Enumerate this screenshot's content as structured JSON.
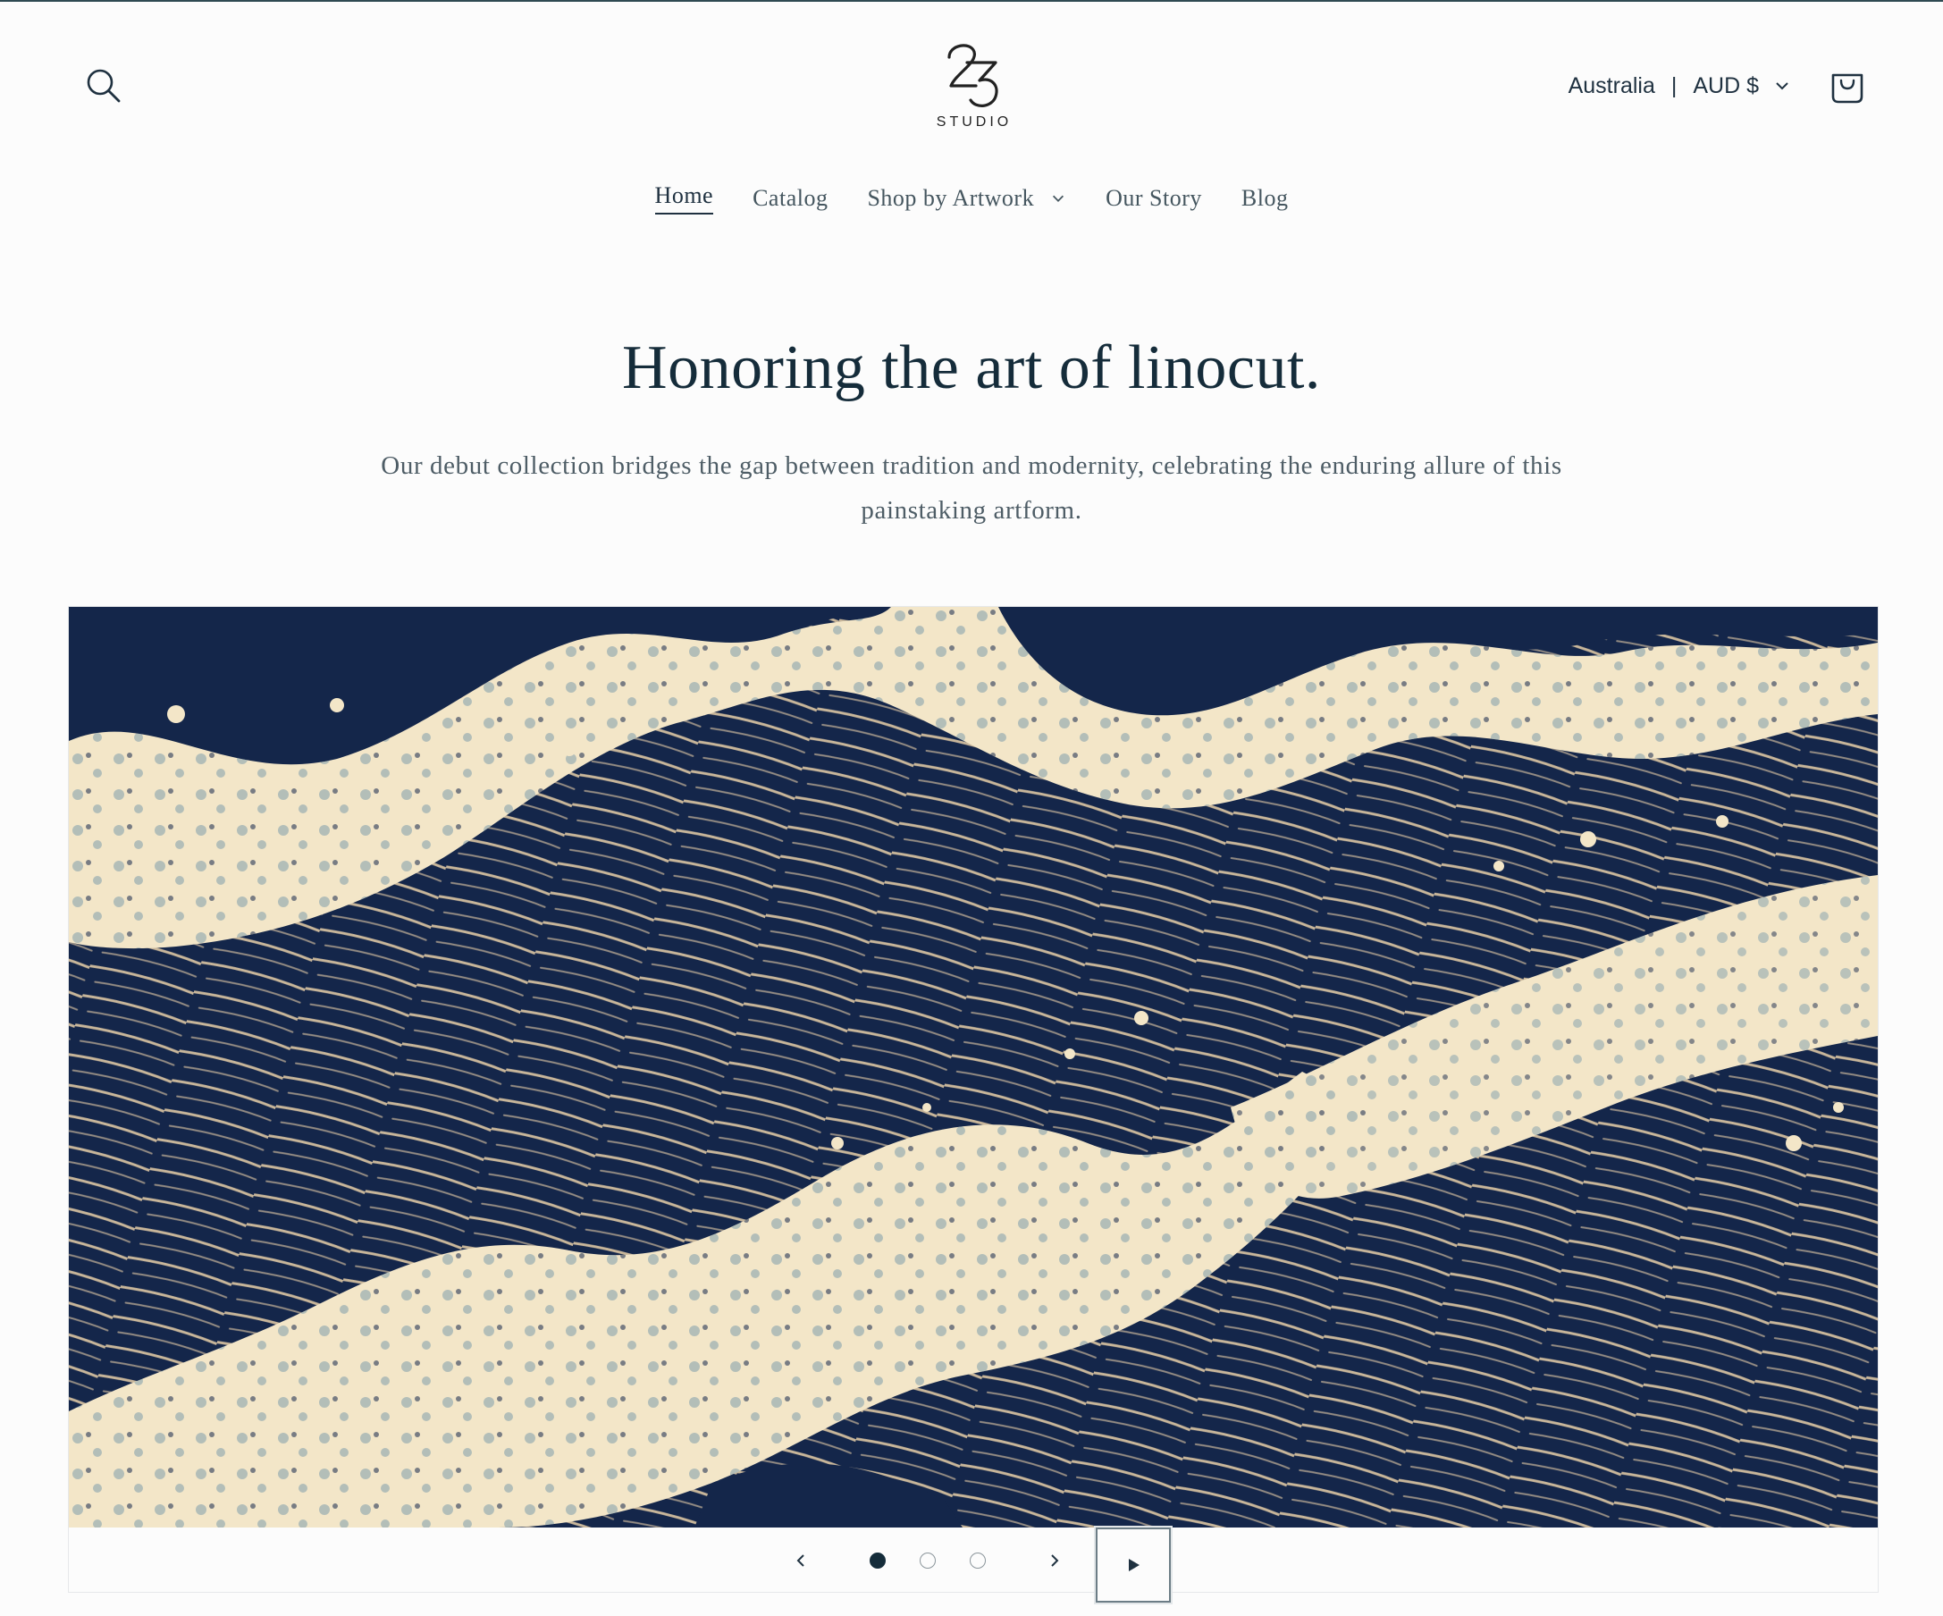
{
  "header": {
    "logo_text": "STUDIO",
    "logo_digits": "23",
    "locale": {
      "country": "Australia",
      "currency": "AUD $"
    }
  },
  "nav": {
    "items": [
      {
        "label": "Home"
      },
      {
        "label": "Catalog"
      },
      {
        "label": "Shop by Artwork"
      },
      {
        "label": "Our Story"
      },
      {
        "label": "Blog"
      }
    ]
  },
  "hero": {
    "title": "Honoring the art of linocut.",
    "subtitle": "Our debut collection bridges the gap between tradition and modernity, celebrating the enduring allure of this painstaking artform."
  },
  "slideshow": {
    "slide_count": 3,
    "active_slide": 1
  },
  "colors": {
    "ink": "#152c3a",
    "wave_navy": "#14264a",
    "foam_cream": "#f3e6c8",
    "foam_blue": "#7f9eab"
  }
}
